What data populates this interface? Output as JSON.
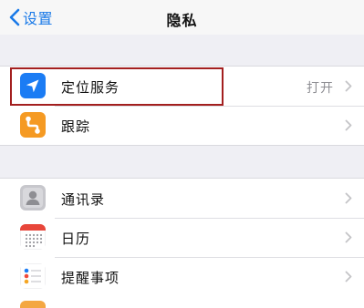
{
  "navbar": {
    "back_label": "设置",
    "title": "隐私"
  },
  "groups": [
    {
      "rows": [
        {
          "label": "定位服务",
          "value": "打开",
          "icon": "location-arrow-icon",
          "icon_color": "#1b7cf4"
        },
        {
          "label": "跟踪",
          "value": "",
          "icon": "tracking-icon",
          "icon_color": "#f59a23"
        }
      ]
    },
    {
      "rows": [
        {
          "label": "通讯录",
          "value": "",
          "icon": "contacts-icon",
          "icon_color": "#b8b8bd"
        },
        {
          "label": "日历",
          "value": "",
          "icon": "calendar-icon",
          "icon_color": "#ffffff"
        },
        {
          "label": "提醒事项",
          "value": "",
          "icon": "reminders-icon",
          "icon_color": "#ffffff"
        }
      ]
    }
  ],
  "colors": {
    "accent": "#1a7ae8",
    "highlight": "#a31f1f",
    "background": "#efeff4"
  }
}
